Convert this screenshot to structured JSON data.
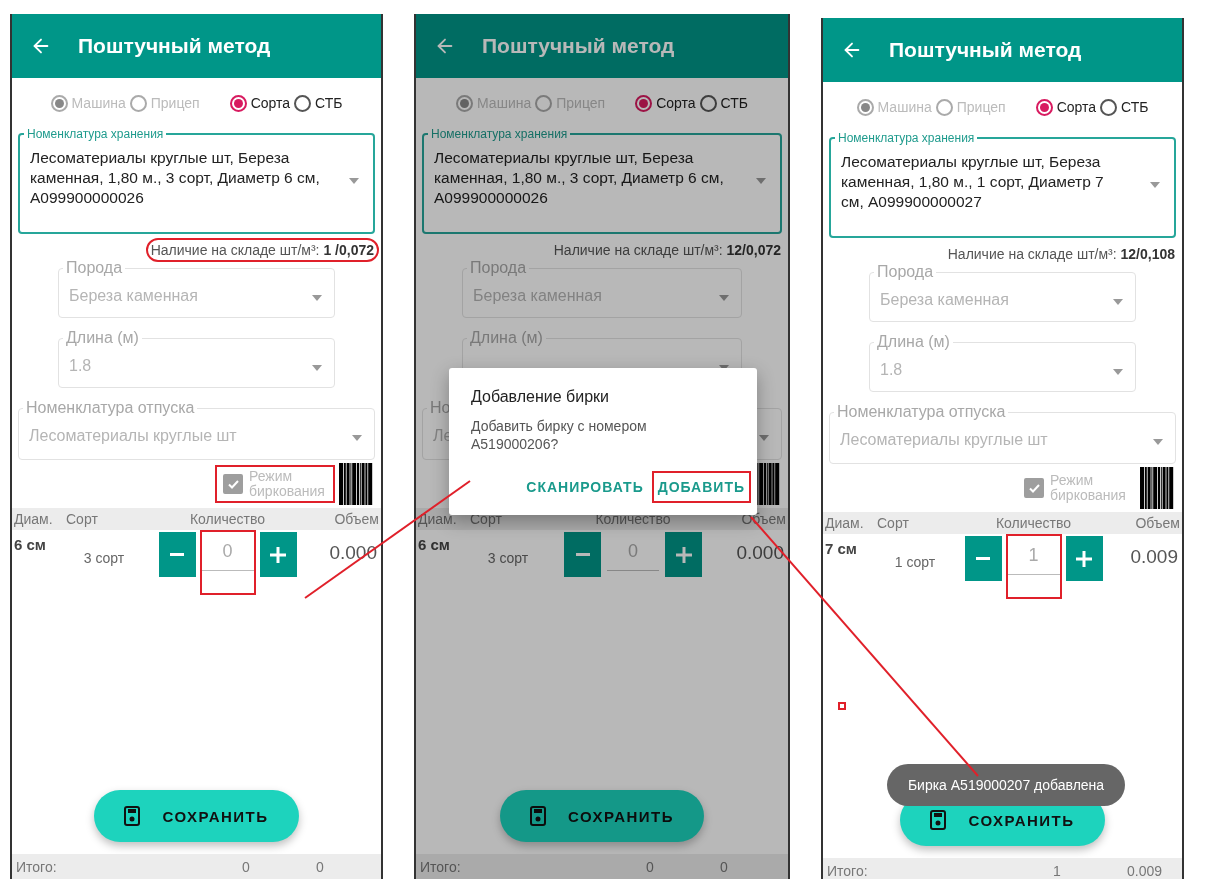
{
  "screens": [
    {
      "title": "Поштучный метод",
      "radio_groups": [
        {
          "disabled": true,
          "options": [
            {
              "label": "Машина",
              "selected": true
            },
            {
              "label": "Прицеп",
              "selected": false
            }
          ]
        },
        {
          "disabled": false,
          "options": [
            {
              "label": "Сорта",
              "selected": true
            },
            {
              "label": "СТБ",
              "selected": false
            }
          ]
        }
      ],
      "storage": {
        "label": "Номенклатура хранения",
        "value": "Лесоматериалы круглые шт, Береза каменная, 1,80 м., 3 сорт, Диаметр 6 см, A099900000026"
      },
      "stock": {
        "text": "Наличие на складе шт/м³: **1 /0,072**",
        "highlighted": true
      },
      "fields": [
        {
          "kind": "narrow",
          "label": "Порода",
          "value": "Береза каменная",
          "disabled": true
        },
        {
          "kind": "narrow",
          "label": "Длина (м)",
          "value": "1.8",
          "disabled": true
        },
        {
          "kind": "wide",
          "label": "Номенклатура отпуска",
          "value": "Лесоматериалы круглые шт",
          "disabled": true
        }
      ],
      "tagging": {
        "label": "Режим биркования",
        "checked": true,
        "disabled": true,
        "highlighted": true
      },
      "columns": [
        "Диам.",
        "Сорт",
        "Количество",
        "Объем"
      ],
      "rows": [
        {
          "diameter": "6 см",
          "grade": "3 сорт",
          "quantity": "0",
          "volume": "0.000",
          "quantity_highlighted": true
        }
      ],
      "save_button": "СОХРАНИТЬ",
      "totals": {
        "label": "Итого:",
        "quantity": "0",
        "volume": "0"
      }
    },
    {
      "title": "Поштучный метод",
      "radio_groups": [
        {
          "disabled": true,
          "options": [
            {
              "label": "Машина",
              "selected": true
            },
            {
              "label": "Прицеп",
              "selected": false
            }
          ]
        },
        {
          "disabled": false,
          "options": [
            {
              "label": "Сорта",
              "selected": true
            },
            {
              "label": "СТБ",
              "selected": false
            }
          ]
        }
      ],
      "storage": {
        "label": "Номенклатура хранения",
        "value": "Лесоматериалы круглые шт, Береза каменная, 1,80 м., 3 сорт, Диаметр 6 см, A099900000026"
      },
      "stock": {
        "text": "Наличие на складе шт/м³: **12/0,072**",
        "highlighted": false
      },
      "fields": [
        {
          "kind": "narrow",
          "label": "Порода",
          "value": "Береза каменная",
          "disabled": true
        },
        {
          "kind": "narrow",
          "label": "Длина (м)",
          "disabled": true
        },
        {
          "kind": "wide",
          "label": "Но",
          "value": "Ле",
          "disabled": true
        }
      ],
      "columns": [
        "Диам.",
        "Сорт",
        "Количество",
        "Объем"
      ],
      "rows": [
        {
          "diameter": "6 см",
          "grade": "3 сорт",
          "quantity": "0",
          "volume": "0.000",
          "quantity_highlighted": false
        }
      ],
      "save_button": "СОХРАНИТЬ",
      "totals": {
        "label": "Итого:",
        "quantity": "0",
        "volume": "0"
      },
      "dialog": {
        "title": "Добавление бирки",
        "message": "Добавить бирку с номером A519000206?",
        "buttons": [
          {
            "label": "СКАНИРОВАТЬ",
            "highlighted": false
          },
          {
            "label": "ДОБАВИТЬ",
            "highlighted": true
          }
        ]
      }
    },
    {
      "title": "Поштучный метод",
      "radio_groups": [
        {
          "disabled": true,
          "options": [
            {
              "label": "Машина",
              "selected": true
            },
            {
              "label": "Прицеп",
              "selected": false
            }
          ]
        },
        {
          "disabled": false,
          "options": [
            {
              "label": "Сорта",
              "selected": true
            },
            {
              "label": "СТБ",
              "selected": false
            }
          ]
        }
      ],
      "storage": {
        "label": "Номенклатура хранения",
        "value": "Лесоматериалы круглые шт, Береза каменная, 1,80 м., 1 сорт, Диаметр 7 см, A099900000027"
      },
      "stock": {
        "text": "Наличие на складе шт/м³: **12/0,108**",
        "highlighted": false
      },
      "fields": [
        {
          "kind": "narrow",
          "label": "Порода",
          "value": "Береза каменная",
          "disabled": true
        },
        {
          "kind": "narrow",
          "label": "Длина (м)",
          "value": "1.8",
          "disabled": true
        },
        {
          "kind": "wide",
          "label": "Номенклатура отпуска",
          "value": "Лесоматериалы круглые шт",
          "disabled": true
        }
      ],
      "tagging": {
        "label": "Режим биркования",
        "checked": true,
        "disabled": true,
        "highlighted": false
      },
      "columns": [
        "Диам.",
        "Сорт",
        "Количество",
        "Объем"
      ],
      "rows": [
        {
          "diameter": "7 см",
          "grade": "1 сорт",
          "quantity": "1",
          "volume": "0.009",
          "quantity_highlighted": true
        }
      ],
      "save_button": "СОХРАНИТЬ",
      "totals": {
        "label": "Итого:",
        "quantity": "1",
        "volume": "0.009"
      },
      "toast": "Бирка A519000207 добавлена"
    }
  ]
}
